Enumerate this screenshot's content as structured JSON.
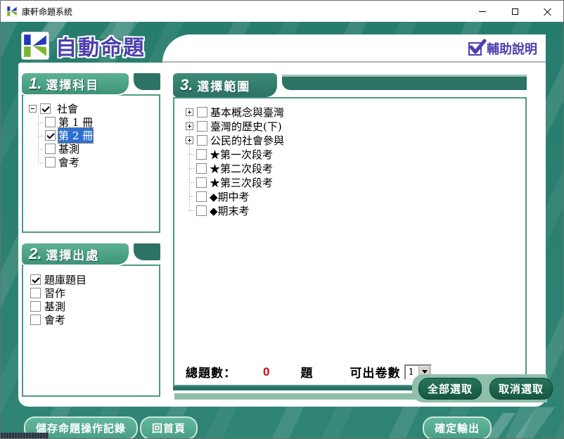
{
  "window": {
    "title": "康軒命題系統"
  },
  "header": {
    "app_title": "自動命題",
    "help_label": "輔助說明"
  },
  "panel1": {
    "number": "1.",
    "title": "選擇科目",
    "tree": {
      "root": {
        "label": "社會",
        "checked": true
      },
      "children": [
        {
          "label": "第 1 冊",
          "checked": false
        },
        {
          "label": "第 2 冊",
          "checked": true,
          "selected": true
        },
        {
          "label": "基測",
          "checked": false
        },
        {
          "label": "會考",
          "checked": false
        }
      ]
    }
  },
  "panel2": {
    "number": "2.",
    "title": "選擇出處",
    "items": [
      {
        "label": "題庫題目",
        "checked": true
      },
      {
        "label": "習作",
        "checked": false
      },
      {
        "label": "基測",
        "checked": false
      },
      {
        "label": "會考",
        "checked": false
      }
    ]
  },
  "panel3": {
    "number": "3.",
    "title": "選擇範圍",
    "tree": [
      {
        "label": "基本概念與臺灣",
        "expandable": true
      },
      {
        "label": "臺灣的歷史(下)",
        "expandable": true
      },
      {
        "label": "公民的社會參與",
        "expandable": true
      },
      {
        "label": "★第一次段考",
        "expandable": false
      },
      {
        "label": "★第二次段考",
        "expandable": false
      },
      {
        "label": "★第三次段考",
        "expandable": false
      },
      {
        "label": "◆期中考",
        "expandable": false
      },
      {
        "label": "◆期末考",
        "expandable": false
      }
    ],
    "summary": {
      "total_label": "總題數：",
      "total_value": "0",
      "unit": "題",
      "papers_label": "可出卷數",
      "papers_value": "1"
    },
    "select_all": "全部選取",
    "deselect": "取消選取"
  },
  "footer": {
    "save_record": "儲存命題操作記錄",
    "home": "回首頁",
    "confirm": "確定輸出"
  },
  "colors": {
    "teal": "#2a8070",
    "panel_border": "#4d9a83",
    "accent_purple": "#4c3fae",
    "selection_blue": "#2e6fd0",
    "zero_red": "#e00000",
    "sage": "#8fbfab",
    "dark_button": "#1d6650"
  }
}
